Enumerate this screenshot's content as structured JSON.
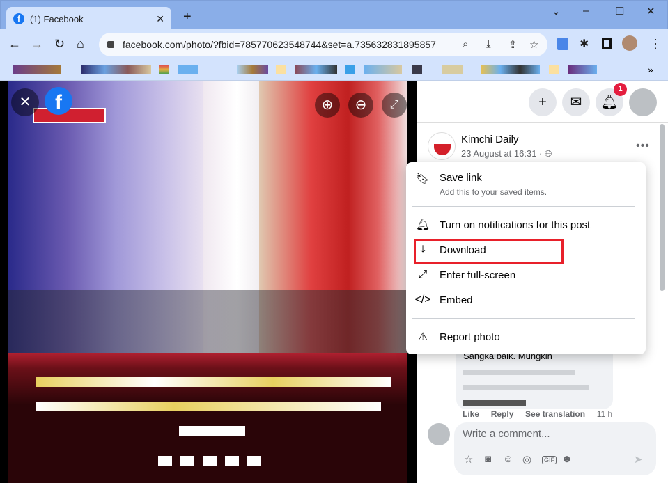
{
  "browser": {
    "tab_title": "(1) Facebook",
    "url": "facebook.com/photo/?fbid=785770623548744&set=a.735632831895857",
    "controls": {
      "minimize": "–",
      "maximize": "☐",
      "close": "✕",
      "tab_search": "⌄",
      "new_tab": "+",
      "bookmarks_more": "»"
    }
  },
  "viewer": {
    "brand": "f",
    "brand_color": "#1877f2"
  },
  "topbar": {
    "notification_count": "1"
  },
  "post": {
    "page_name": "Kimchi Daily",
    "date": "23 August at 16:31 · "
  },
  "menu": {
    "items": [
      {
        "label": "Save link",
        "sub": "Add this to your saved items.",
        "icon": "bookmark-icon"
      },
      {
        "label": "Turn on notifications for this post",
        "icon": "bell-icon"
      },
      {
        "label": "Download",
        "icon": "download-icon",
        "highlighted": true
      },
      {
        "label": "Enter full-screen",
        "icon": "expand-icon"
      },
      {
        "label": "Embed",
        "icon": "code-icon"
      },
      {
        "label": "Report photo",
        "icon": "report-icon"
      }
    ],
    "highlight_color": "#e8202a"
  },
  "comment": {
    "partial_text": "Sangka baik. Mungkin",
    "actions": [
      "Like",
      "Reply",
      "See translation",
      "11 h"
    ]
  },
  "composer": {
    "placeholder": "Write a comment..."
  }
}
